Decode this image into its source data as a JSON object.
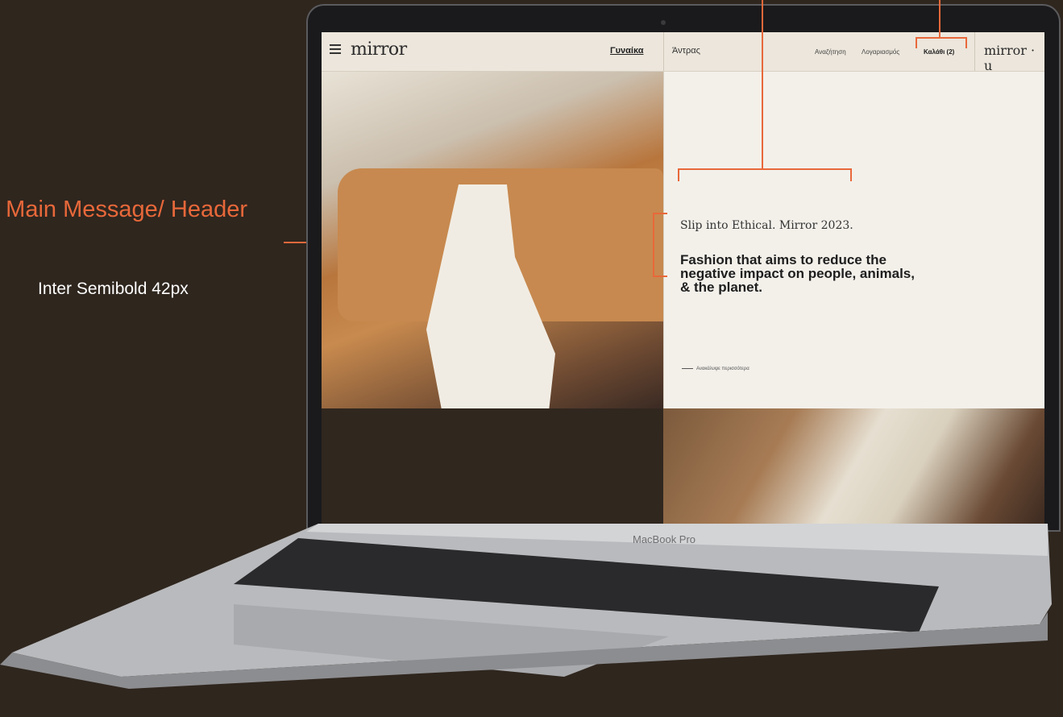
{
  "annotation": {
    "title": "Main Message/ Header",
    "subtitle": "Inter Semibold  42px",
    "accent": "#e8683a"
  },
  "device": {
    "label": "MacBook Pro"
  },
  "site": {
    "logo": "mirror",
    "logo_u": "mirror · u",
    "nav": {
      "women": "Γυναίκα",
      "men": "Άντρας",
      "search": "Αναζήτηση",
      "account": "Λογαριασμός",
      "cart": "Καλάθι (2)"
    },
    "hero": {
      "eyebrow": "Slip into Ethical. Mirror 2023.",
      "headline": "Fashion that aims to reduce the negative impact on people, animals, & the planet.",
      "cta": "Ανακάλυψε περισσότερα"
    }
  }
}
